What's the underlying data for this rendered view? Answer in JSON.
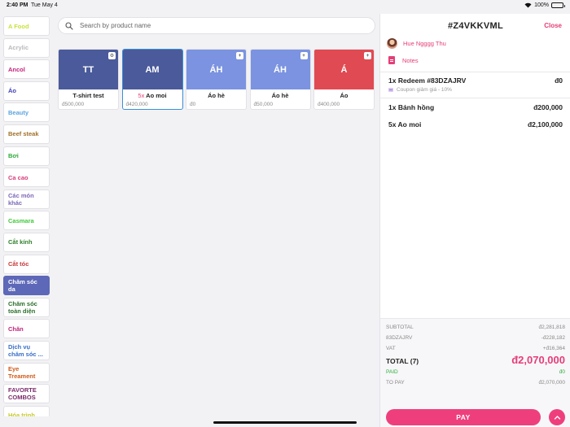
{
  "status": {
    "time": "2:40 PM",
    "date": "Tue May 4",
    "battery": "100%"
  },
  "search": {
    "placeholder": "Search by product name"
  },
  "categories": [
    {
      "label": "A Food",
      "color": "#c8e23a",
      "active": false
    },
    {
      "label": "Acrylic",
      "color": "#b9b9bd",
      "active": false
    },
    {
      "label": "Ancol",
      "color": "#c0247a",
      "active": false
    },
    {
      "label": "Áo",
      "color": "#3f3fb8",
      "active": false
    },
    {
      "label": "Beauty",
      "color": "#5da3e0",
      "active": false
    },
    {
      "label": "Beef steak",
      "color": "#a2702a",
      "active": false
    },
    {
      "label": "Bơi",
      "color": "#2fa83a",
      "active": false
    },
    {
      "label": "Ca cao",
      "color": "#d83e7a",
      "active": false
    },
    {
      "label": "Các món khác",
      "color": "#7d68b8",
      "active": false
    },
    {
      "label": "Casmara",
      "color": "#3fc83a",
      "active": false
    },
    {
      "label": "Cắt kính",
      "color": "#2f7f2a",
      "active": false
    },
    {
      "label": "Cắt tóc",
      "color": "#c83a3a",
      "active": false
    },
    {
      "label": "Chăm sóc da",
      "color": "#ffffff",
      "active": true
    },
    {
      "label": "Chăm sóc toàn diện",
      "color": "#2a6f2a",
      "active": false
    },
    {
      "label": "Chăn",
      "color": "#c0247a",
      "active": false
    },
    {
      "label": "Dịch vụ chăm sóc ...",
      "color": "#3a6fc8",
      "active": false
    },
    {
      "label": "Eye Treament",
      "color": "#d05a1a",
      "active": false
    },
    {
      "label": "FAVORTE COMBOS",
      "color": "#7a2a6a",
      "active": false
    },
    {
      "label": "Hóa trình",
      "color": "#c8c82a",
      "active": false
    }
  ],
  "products": [
    {
      "initials": "TT",
      "name": "T-shirt test",
      "qty": "",
      "price": "đ500,000",
      "color": "#4a5a9a",
      "badge": "⚙",
      "selected": false
    },
    {
      "initials": "AM",
      "name": "Ao moi",
      "qty": "5x",
      "price": "đ420,000",
      "color": "#4a5a9a",
      "badge": "",
      "selected": true
    },
    {
      "initials": "ÁH",
      "name": "Áo hè",
      "qty": "",
      "price": "đ0",
      "color": "#7b93e0",
      "badge": "+",
      "selected": false
    },
    {
      "initials": "ÁH",
      "name": "Áo hè",
      "qty": "",
      "price": "đ50,000",
      "color": "#7b93e0",
      "badge": "+",
      "selected": false
    },
    {
      "initials": "Á",
      "name": "Áo",
      "qty": "",
      "price": "đ400,000",
      "color": "#e04a52",
      "badge": "+",
      "selected": false
    }
  ],
  "order": {
    "id": "#Z4VKKVML",
    "close_label": "Close",
    "customer": "Hue Ngggg Thu",
    "notes_label": "Notes",
    "lines": [
      {
        "label": "1x Redeem #83DZAJRV",
        "amount": "đ0",
        "sub": "Coupon giảm giá - 10%"
      },
      {
        "label": "1x Bánh hồng",
        "amount": "đ200,000",
        "sub": ""
      },
      {
        "label": "5x Ao moi",
        "amount": "đ2,100,000",
        "sub": ""
      }
    ],
    "summary": {
      "subtotal_label": "SUBTOTAL",
      "subtotal": "đ2,281,818",
      "coupon_label": "83DZAJRV",
      "coupon": "-đ228,182",
      "vat_label": "VAT",
      "vat": "+đ16,364",
      "total_label": "TOTAL (7)",
      "total": "đ2,070,000",
      "paid_label": "PAID",
      "paid": "đ0",
      "topay_label": "TO PAY",
      "topay": "đ2,070,000"
    },
    "pay_label": "PAY"
  }
}
